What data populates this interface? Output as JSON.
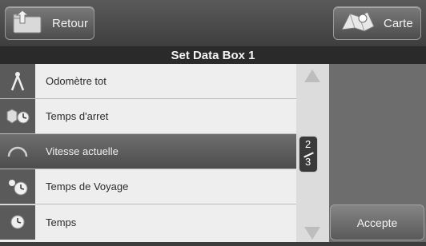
{
  "header": {
    "back_label": "Retour",
    "map_label": "Carte",
    "title": "Set Data Box 1"
  },
  "list": {
    "items": [
      {
        "label": "Odomètre tot",
        "icon": "compass-icon"
      },
      {
        "label": "Temps d'arret",
        "icon": "stop-clock-icon"
      },
      {
        "label": "Vitesse actuelle",
        "icon": "speedometer-icon",
        "selected": true
      },
      {
        "label": "Temps de Voyage",
        "icon": "travel-time-icon"
      },
      {
        "label": "Temps",
        "icon": "clock-icon"
      }
    ]
  },
  "pager": {
    "current": "2",
    "total": "3"
  },
  "accept_label": "Accepte",
  "colors": {
    "selected_row": "#5c5c5c",
    "list_bg": "#eeeeee",
    "panel_bg": "#6d6d6d"
  }
}
